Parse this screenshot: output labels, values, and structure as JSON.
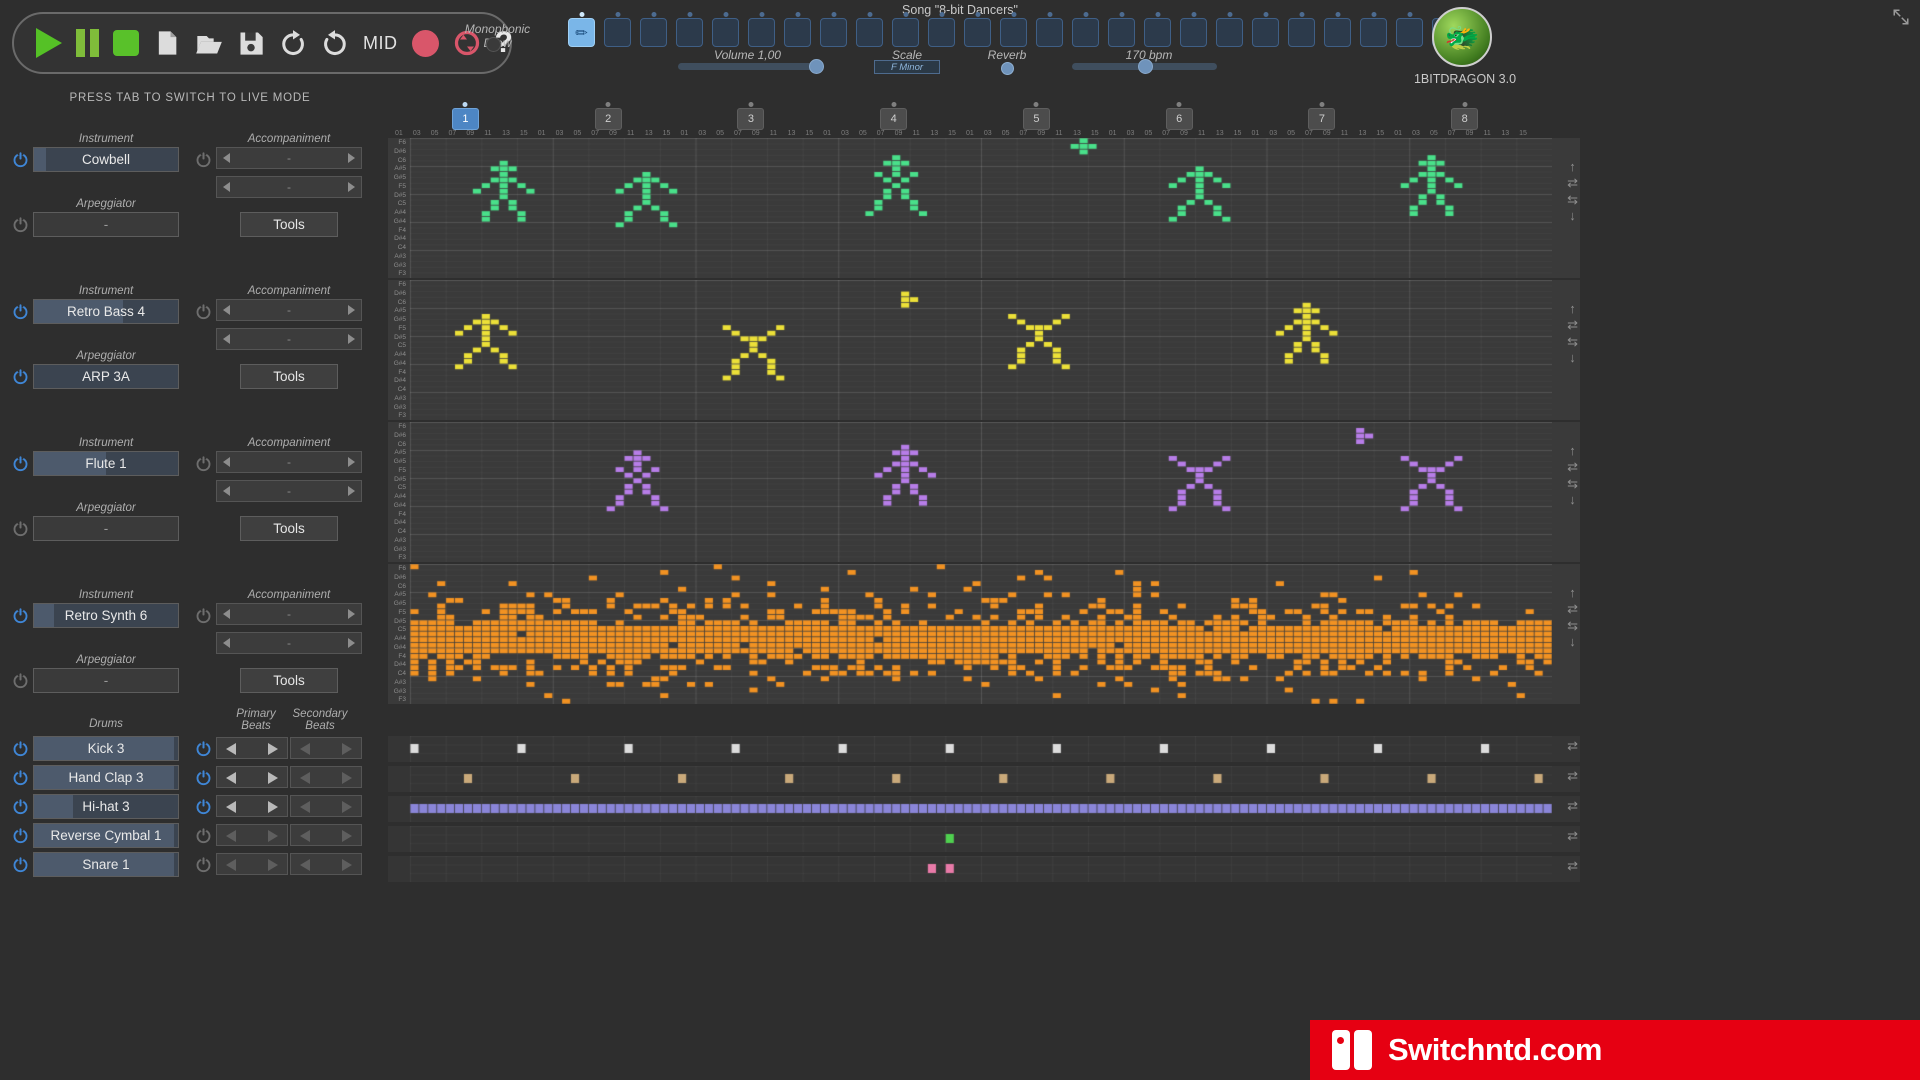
{
  "app": {
    "brand": "1BITDRAGON 3.0",
    "song_title": "Song \"8-bit Dancers\"",
    "live_mode_hint": "PRESS TAB TO SWITCH TO LIVE MODE",
    "logo_icon": "dragon-logo",
    "expand_icon": "expand-icon"
  },
  "transport": {
    "buttons": [
      {
        "name": "play-button",
        "icon": "play-icon",
        "label": ""
      },
      {
        "name": "pause-button",
        "icon": "pause-icon",
        "label": ""
      },
      {
        "name": "stop-button",
        "icon": "stop-icon",
        "label": ""
      },
      {
        "name": "new-button",
        "icon": "new-file-icon",
        "label": ""
      },
      {
        "name": "open-button",
        "icon": "open-folder-icon",
        "label": ""
      },
      {
        "name": "save-button",
        "icon": "save-disk-icon",
        "label": ""
      },
      {
        "name": "undo-button",
        "icon": "undo-arrow-icon",
        "label": ""
      },
      {
        "name": "redo-button",
        "icon": "redo-arrow-icon",
        "label": ""
      },
      {
        "name": "midi-button",
        "icon": "text-label",
        "label": "MID"
      },
      {
        "name": "record-button",
        "icon": "record-circle-icon",
        "label": ""
      },
      {
        "name": "loop-button",
        "icon": "loop-refresh-icon",
        "label": ""
      },
      {
        "name": "help-button",
        "icon": "question-mark-icon",
        "label": "?"
      }
    ]
  },
  "controls": {
    "mono_draw_label": "Monophonic Draw",
    "volume_label": "Volume 1,00",
    "volume_value": 100,
    "scale_label": "Scale",
    "scale_value": "F Minor",
    "reverb_label": "Reverb",
    "reverb_value": 0,
    "bpm_label": "170 bpm",
    "bpm_value": 170
  },
  "slots": {
    "count": 25,
    "selected_index": 0,
    "selected_icon": "pencil-icon"
  },
  "tracks": [
    {
      "instrument_label": "Instrument",
      "instrument_value": "Cowbell",
      "instrument_power": true,
      "instrument_fill_pct": 8,
      "arp_label": "Arpeggiator",
      "arp_value": "-",
      "arp_power": false,
      "acc_label": "Accompaniment",
      "acc_power": false,
      "acc_values": [
        "-",
        "-"
      ],
      "tools_label": "Tools"
    },
    {
      "instrument_label": "Instrument",
      "instrument_value": "Retro Bass 4",
      "instrument_power": true,
      "instrument_fill_pct": 62,
      "arp_label": "Arpeggiator",
      "arp_value": "ARP 3A",
      "arp_power": true,
      "acc_label": "Accompaniment",
      "acc_power": false,
      "acc_values": [
        "-",
        "-"
      ],
      "tools_label": "Tools"
    },
    {
      "instrument_label": "Instrument",
      "instrument_value": "Flute 1",
      "instrument_power": true,
      "instrument_fill_pct": 50,
      "arp_label": "Arpeggiator",
      "arp_value": "-",
      "arp_power": false,
      "acc_label": "Accompaniment",
      "acc_power": false,
      "acc_values": [
        "-",
        "-"
      ],
      "tools_label": "Tools"
    },
    {
      "instrument_label": "Instrument",
      "instrument_value": "Retro Synth 6",
      "instrument_power": true,
      "instrument_fill_pct": 14,
      "arp_label": "Arpeggiator",
      "arp_value": "-",
      "arp_power": false,
      "acc_label": "Accompaniment",
      "acc_power": false,
      "acc_values": [
        "-",
        "-"
      ],
      "tools_label": "Tools"
    }
  ],
  "drums": {
    "section_label": "Drums",
    "primary_label": "Primary\nBeats",
    "primary_label_l1": "Primary",
    "primary_label_l2": "Beats",
    "secondary_label_l1": "Secondary",
    "secondary_label_l2": "Beats",
    "rows": [
      {
        "name": "Kick 3",
        "power": true,
        "beats_power": true,
        "fill_pct": 97,
        "beats_active": true
      },
      {
        "name": "Hand Clap 3",
        "power": true,
        "beats_power": true,
        "fill_pct": 97,
        "beats_active": true
      },
      {
        "name": "Hi-hat 3",
        "power": true,
        "beats_power": true,
        "fill_pct": 27,
        "beats_active": true
      },
      {
        "name": "Reverse Cymbal 1",
        "power": true,
        "beats_power": false,
        "fill_pct": 97,
        "beats_active": false
      },
      {
        "name": "Snare 1",
        "power": true,
        "beats_power": false,
        "fill_pct": 97,
        "beats_active": false
      }
    ]
  },
  "timeline": {
    "bars": [
      "1",
      "2",
      "3",
      "4",
      "5",
      "6",
      "7",
      "8"
    ],
    "active_bar": "1",
    "tick_labels": [
      "01",
      "03",
      "05",
      "07",
      "09",
      "11",
      "13",
      "15"
    ]
  },
  "piano_roll": {
    "key_labels": [
      "F6",
      "D#6",
      "C6",
      "A#5",
      "G#5",
      "F5",
      "D#5",
      "C5",
      "A#4",
      "G#4",
      "F4",
      "D#4",
      "C4",
      "A#3",
      "G#3",
      "F3"
    ],
    "side_buttons": [
      "transpose-up",
      "shift-right",
      "shift-left",
      "transpose-down"
    ],
    "lanes": [
      {
        "track": "Cowbell",
        "color": "#49e08a",
        "note_count": 118
      },
      {
        "track": "Retro Bass 4",
        "color": "#ece038",
        "note_count": 129
      },
      {
        "track": "Flute 1",
        "color": "#b77de8",
        "note_count": 124
      },
      {
        "track": "Retro Synth 6",
        "color": "#f29222",
        "note_count": 1180
      }
    ],
    "drum_lanes": [
      {
        "track": "Kick 3",
        "color": "#dcdcdc",
        "note_count": 11
      },
      {
        "track": "Hand Clap 3",
        "color": "#c9a97a",
        "note_count": 13
      },
      {
        "track": "Hi-hat 3",
        "color": "#8a85d8",
        "note_count": 96
      },
      {
        "track": "Reverse Cymbal 1",
        "color": "#4fd04f",
        "note_count": 1
      },
      {
        "track": "Snare 1",
        "color": "#e87aa8",
        "note_count": 2
      }
    ]
  },
  "watermark": {
    "text": "Switchntd.com",
    "accent": "#e60012"
  }
}
